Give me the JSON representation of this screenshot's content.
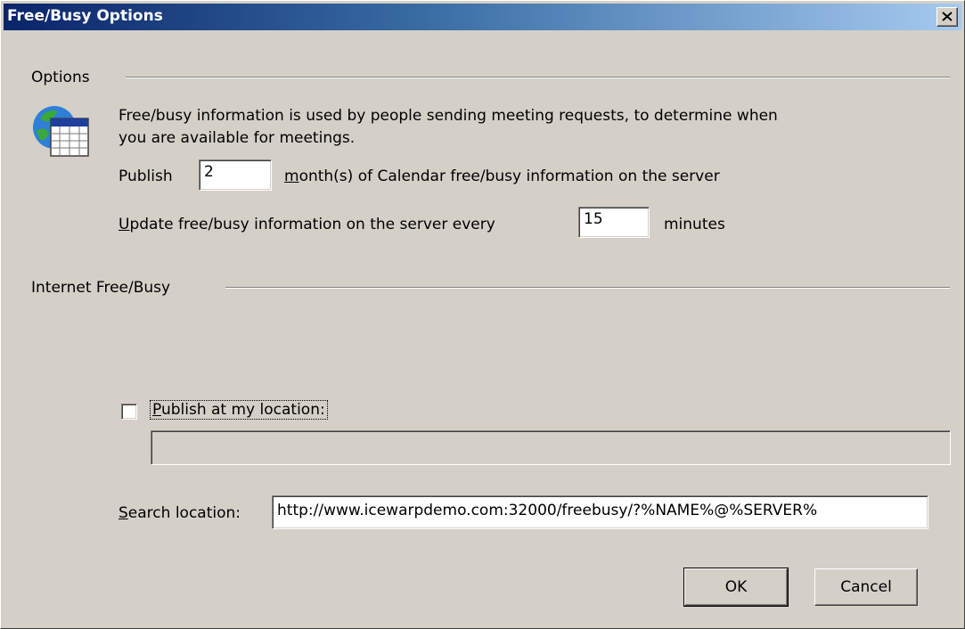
{
  "window": {
    "title": "Free/Busy Options",
    "close_glyph": "×"
  },
  "options_group": {
    "label": "Options",
    "icon": "calendar-globe-icon",
    "description_line1": "Free/busy information is used by people sending meeting requests, to determine when",
    "description_line2": "you are available for meetings.",
    "publish_label": "Publish",
    "publish_months_value": "2",
    "months_mnemonic": "m",
    "months_rest": "onth(s) of Calendar free/busy information on the server",
    "update_mnemonic": "U",
    "update_rest": "pdate free/busy information on the server every",
    "update_minutes_value": "15",
    "minutes_label": "minutes"
  },
  "internet_group": {
    "label": "Internet Free/Busy",
    "publish_checkbox_checked": false,
    "publish_mnemonic": "P",
    "publish_rest": "ublish at my location:",
    "publish_location_value": "",
    "search_mnemonic": "S",
    "search_rest": "earch location:",
    "search_location_value": "http://www.icewarpdemo.com:32000/freebusy/?%NAME%@%SERVER%"
  },
  "buttons": {
    "ok_label": "OK",
    "cancel_label": "Cancel"
  }
}
